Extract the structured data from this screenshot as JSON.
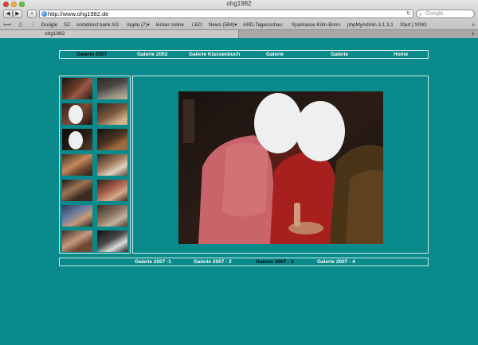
{
  "window": {
    "title": "ohg1982"
  },
  "toolbar": {
    "back_glyph": "◀",
    "forward_glyph": "▶",
    "add_glyph": "+",
    "url": "http://www.ohg1982.de",
    "reload_glyph": "↻",
    "search_placeholder": "Google"
  },
  "bookmarks": {
    "icons": "⟺ ▯ ⋮⋮⋮",
    "items": [
      "Google",
      "SZ",
      "comdirect bank AG",
      "Apple (7)▾",
      "kicker online",
      "LEO",
      "News (584)▾",
      "ARD-Tagesschau",
      "Sparkasse Köln-Bonn",
      "phpMyAdmin 3.1.3.1",
      "Start | XING"
    ],
    "more": "»"
  },
  "tab": {
    "label": "ohg1982",
    "add_glyph": "+"
  },
  "page": {
    "topnav": [
      {
        "label": "Galerie 2007",
        "active": true
      },
      {
        "label": "Galerie 2002",
        "active": false
      },
      {
        "label": "Galerie Klassenbuch",
        "active": false
      },
      {
        "label": "Galerie",
        "active": false
      },
      {
        "label": "Galerie",
        "active": false
      },
      {
        "label": "Home",
        "active": false
      }
    ],
    "subnav": [
      {
        "label": "Galerie 2007 -1",
        "active": false
      },
      {
        "label": "Galerie 2007 - 2",
        "active": false
      },
      {
        "label": "Galerie 2007 - 3",
        "active": true
      },
      {
        "label": "Galerie 2007 - 4",
        "active": false
      }
    ],
    "thumbnails_count": 14
  },
  "colors": {
    "page_bg": "#0a8a8a",
    "border": "#cfe9e9",
    "active_link": "#0a0a0a",
    "link": "#ffffff"
  }
}
